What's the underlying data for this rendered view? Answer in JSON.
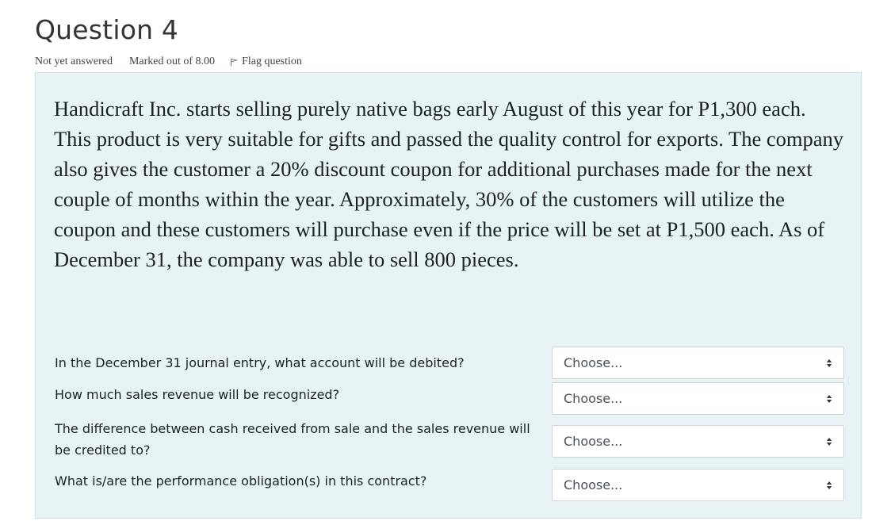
{
  "question": {
    "title": "Question 4",
    "status": "Not yet answered",
    "marks": "Marked out of 8.00",
    "flag_label": "Flag question",
    "text": "Handicraft Inc. starts selling purely native bags early August of this year for P1,300 each.  This product is very suitable for gifts and passed the quality control for exports.  The company also gives the customer a 20% discount coupon for additional purchases made for the next couple of months within the year.  Approximately, 30% of the customers will utilize the coupon and these customers will purchase even if the price will be set at P1,500 each.  As of December 31, the company was able to sell 800 pieces."
  },
  "subquestions": [
    {
      "label": "In the December 31 journal entry, what account will be debited?",
      "select_value": "Choose..."
    },
    {
      "label": "How much sales revenue will be recognized?",
      "select_value": "Choose..."
    },
    {
      "label": "The difference between cash received from sale and the sales revenue will be credited to?",
      "select_value": "Choose..."
    },
    {
      "label": "What is/are the performance obligation(s) in this contract?",
      "select_value": "Choose..."
    }
  ],
  "icons": {
    "flag": "flag-icon",
    "select_arrows": "sort-arrows-icon"
  }
}
